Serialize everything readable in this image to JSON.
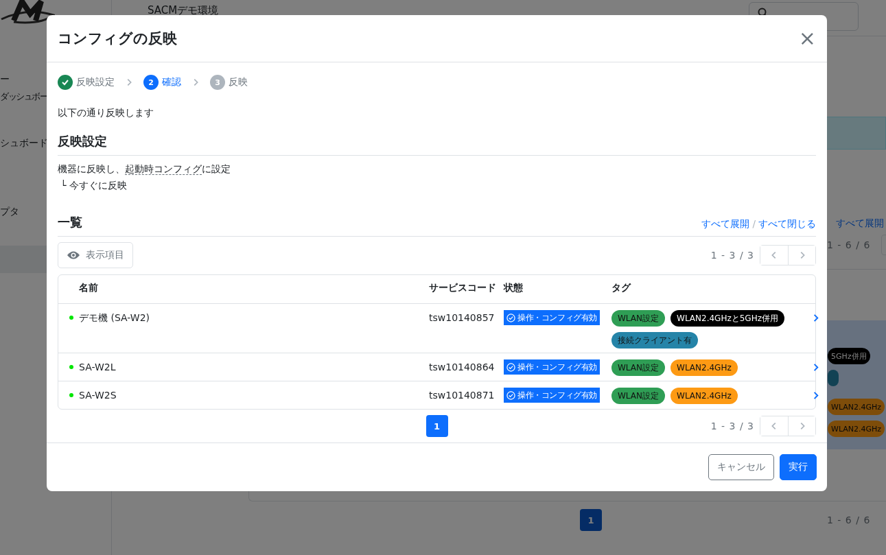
{
  "background": {
    "sidebar_items": [
      "ー",
      "ダッシュボー",
      "シュボード",
      "プタ"
    ],
    "header_title": "SACMデモ環境",
    "expand_link": "すべて展開",
    "range_top": "1 - 6 / 6",
    "tags": [
      {
        "label": "5GHz併用",
        "kind": "dark"
      },
      {
        "kind": "client"
      },
      {
        "label": "WLAN2.4GHz",
        "kind": "band"
      },
      {
        "label": "WLAN2.4GHz",
        "kind": "band"
      }
    ],
    "page": "1",
    "range_bottom": "1 - 6 / 6"
  },
  "dialog": {
    "title": "コンフィグの反映",
    "close": "×",
    "steps": [
      {
        "label": "反映設定",
        "completed": true,
        "selected": false
      },
      {
        "number": "2",
        "label": "確認",
        "completed": false,
        "selected": true
      },
      {
        "number": "3",
        "label": "反映",
        "completed": false,
        "selected": false
      }
    ],
    "intro": "以下の通り反映します",
    "settings": {
      "heading": "反映設定",
      "line": {
        "before": "機器に反映し、",
        "term": "起動時コンフィグ",
        "after": "に設定"
      },
      "sub": "└ 今すぐに反映"
    },
    "list": {
      "heading": "一覧",
      "expand_all": "すべて展開",
      "separator": "/",
      "collapse_all": "すべて閉じる",
      "columns_button": "表示項目",
      "range": "1 - 3 / 3",
      "columns": [
        "名前",
        "サービスコード",
        "状態",
        "タグ"
      ],
      "rows": [
        {
          "name": "デモ機 (SA-W2)",
          "online": true,
          "code": "tsw10140857",
          "status": "操作・コンフィグ有効",
          "tags": [
            {
              "label": "WLAN設定",
              "color": "#2f9e55"
            },
            {
              "label": "WLAN2.4GHzと5GHz併用",
              "color": "#000000"
            },
            {
              "label": "接続クライアント有",
              "color": "#2584a8"
            }
          ]
        },
        {
          "name": "SA-W2L",
          "online": true,
          "code": "tsw10140864",
          "status": "操作・コンフィグ有効",
          "tags": [
            {
              "label": "WLAN設定",
              "color": "#2f9e55"
            },
            {
              "label": "WLAN2.4GHz",
              "color": "#fd9a14"
            }
          ]
        },
        {
          "name": "SA-W2S",
          "online": true,
          "code": "tsw10140871",
          "status": "操作・コンフィグ有効",
          "tags": [
            {
              "label": "WLAN設定",
              "color": "#2f9e55"
            },
            {
              "label": "WLAN2.4GHz",
              "color": "#fd9a14"
            }
          ]
        }
      ],
      "pages": [
        {
          "label": "1",
          "selected": true
        }
      ],
      "range_bottom": "1 - 3 / 3"
    },
    "buttons": [
      {
        "label": "キャンセル",
        "kind": "secondary"
      },
      {
        "label": "実行",
        "kind": "primary"
      }
    ]
  }
}
